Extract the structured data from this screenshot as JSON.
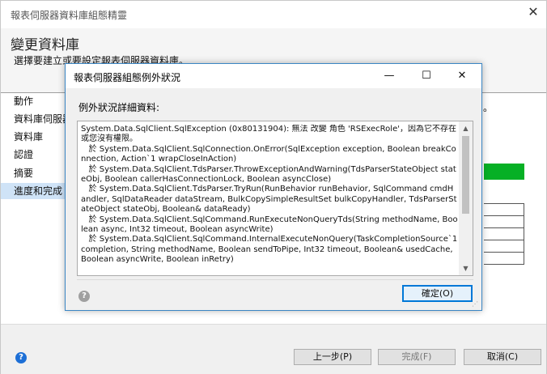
{
  "wizard": {
    "title": "報表伺服器資料庫組態精靈",
    "heading": "變更資料庫",
    "subtitle": "選擇要建立或要設定報表伺服器資料庫。",
    "nav_items": [
      "動作",
      "資料庫伺服器",
      "資料庫",
      "認證",
      "摘要",
      "進度和完成"
    ],
    "active_nav_index": 5,
    "status_dot": "。",
    "progress_color": "#06b025",
    "buttons": {
      "back": "上一步(P)",
      "finish": "完成(F)",
      "cancel": "取消(C)"
    }
  },
  "dialog": {
    "title": "報表伺服器組態例外狀況",
    "minimize_glyph": "—",
    "maximize_glyph": "☐",
    "close_glyph": "✕",
    "section_label": "例外狀況詳細資料:",
    "exception_text": "System.Data.SqlClient.SqlException (0x80131904): 無法 改變 角色 'RSExecRole'，因為它不存在或您沒有權限。\n   於 System.Data.SqlClient.SqlConnection.OnError(SqlException exception, Boolean breakConnection, Action`1 wrapCloseInAction)\n   於 System.Data.SqlClient.TdsParser.ThrowExceptionAndWarning(TdsParserStateObject stateObj, Boolean callerHasConnectionLock, Boolean asyncClose)\n   於 System.Data.SqlClient.TdsParser.TryRun(RunBehavior runBehavior, SqlCommand cmdHandler, SqlDataReader dataStream, BulkCopySimpleResultSet bulkCopyHandler, TdsParserStateObject stateObj, Boolean& dataReady)\n   於 System.Data.SqlClient.SqlCommand.RunExecuteNonQueryTds(String methodName, Boolean async, Int32 timeout, Boolean asyncWrite)\n   於 System.Data.SqlClient.SqlCommand.InternalExecuteNonQuery(TaskCompletionSource`1 completion, String methodName, Boolean sendToPipe, Int32 timeout, Boolean& usedCache, Boolean asyncWrite, Boolean inRetry)",
    "ok_label": "確定(O)",
    "scroll_up": "▲",
    "scroll_down": "▼"
  },
  "icons": {
    "help": "?",
    "close": "✕",
    "grip": "⋰"
  },
  "colors": {
    "accent": "#0078d7",
    "dialog_border": "#3b86c4",
    "nav_active": "#cfe3f7"
  }
}
